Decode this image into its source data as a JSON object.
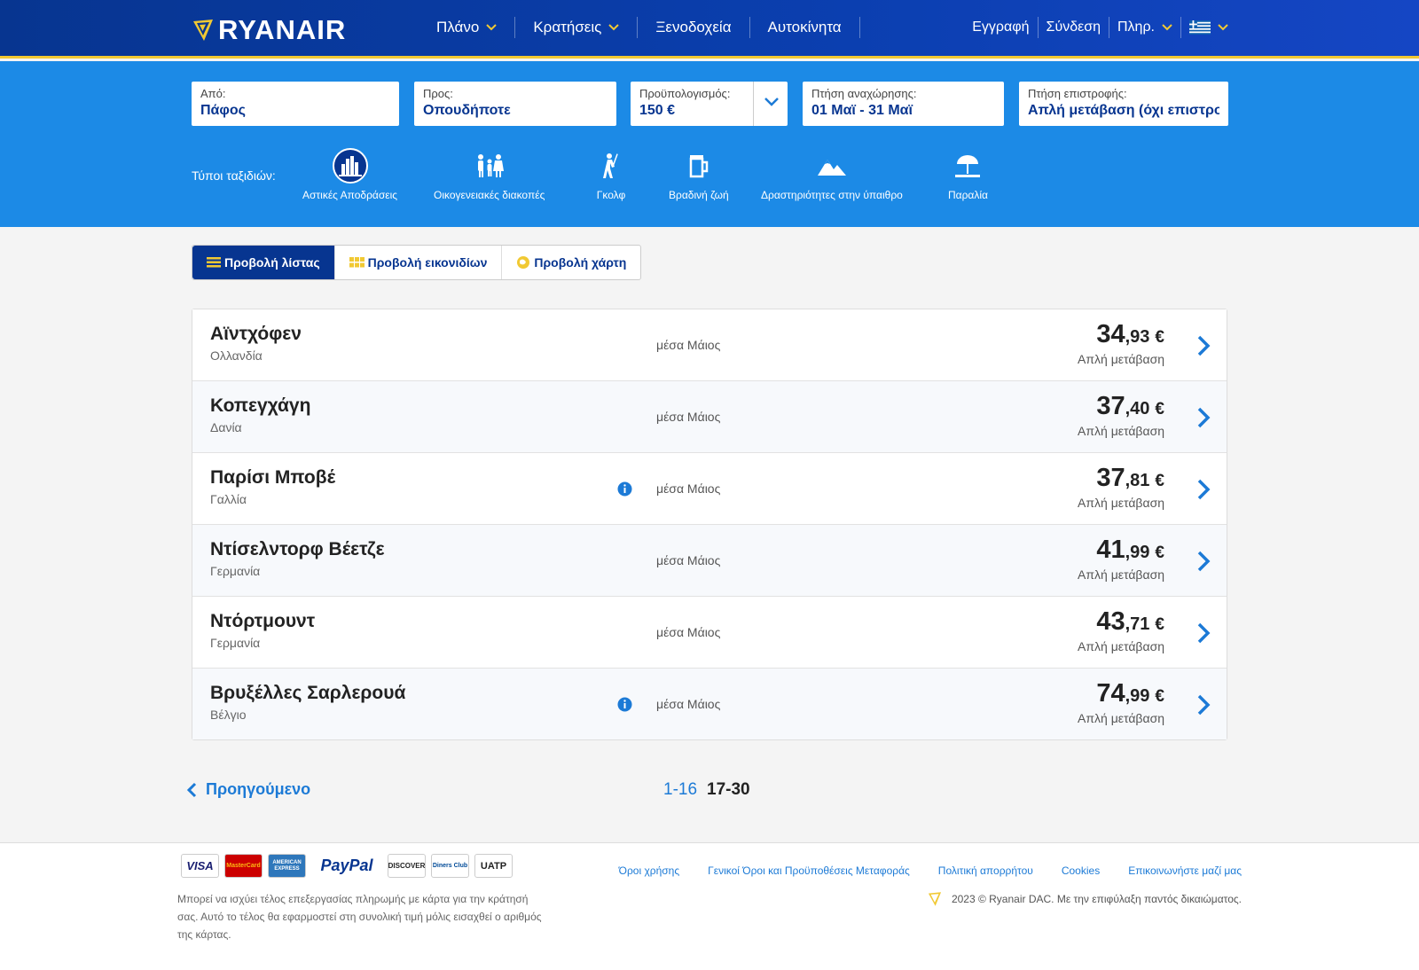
{
  "brand": {
    "name": "RYANAIR"
  },
  "nav": {
    "left": [
      {
        "label": "Πλάνο",
        "has_dropdown": true
      },
      {
        "label": "Κρατήσεις",
        "has_dropdown": true
      },
      {
        "label": "Ξενοδοχεία",
        "has_dropdown": false
      },
      {
        "label": "Αυτοκίνητα",
        "has_dropdown": false
      }
    ],
    "right": [
      {
        "label": "Εγγραφή"
      },
      {
        "label": "Σύνδεση"
      },
      {
        "label": "Πληρ."
      }
    ],
    "language_icon": "greece-flag-icon"
  },
  "search": {
    "from": {
      "label": "Από:",
      "value": "Πάφος"
    },
    "to": {
      "label": "Προς:",
      "value": "Οπουδήποτε"
    },
    "budget": {
      "label": "Προϋπολογισμός:",
      "value": "150 €"
    },
    "departure": {
      "label": "Πτήση αναχώρησης:",
      "value": "01 Μαϊ - 31 Μαϊ"
    },
    "return": {
      "label": "Πτήση επιστροφής:",
      "value": "Απλή μετάβαση (όχι επιστροφή)"
    }
  },
  "trip_types": {
    "label": "Τύποι ταξιδιών:",
    "items": [
      {
        "label": "Αστικές Αποδράσεις",
        "icon": "city-icon",
        "active": true
      },
      {
        "label": "Οικογενειακές διακοπές",
        "icon": "family-icon",
        "active": false
      },
      {
        "label": "Γκολφ",
        "icon": "golf-icon",
        "active": false
      },
      {
        "label": "Βραδινή ζωή",
        "icon": "beer-icon",
        "active": false
      },
      {
        "label": "Δραστηριότητες στην ύπαιθρο",
        "icon": "mountains-icon",
        "active": false
      },
      {
        "label": "Παραλία",
        "icon": "beach-icon",
        "active": false
      }
    ]
  },
  "views": {
    "list": "Προβολή λίστας",
    "grid": "Προβολή εικονιδίων",
    "map": "Προβολή χάρτη"
  },
  "results": [
    {
      "city": "Αϊντχόφεν",
      "country": "Ολλανδία",
      "info": false,
      "when": "μέσα Μάιος",
      "price_int": "34",
      "price_dec": ",93",
      "currency": "€",
      "type": "Απλή μετάβαση"
    },
    {
      "city": "Κοπεγχάγη",
      "country": "Δανία",
      "info": false,
      "when": "μέσα Μάιος",
      "price_int": "37",
      "price_dec": ",40",
      "currency": "€",
      "type": "Απλή μετάβαση"
    },
    {
      "city": "Παρίσι Μποβέ",
      "country": "Γαλλία",
      "info": true,
      "when": "μέσα Μάιος",
      "price_int": "37",
      "price_dec": ",81",
      "currency": "€",
      "type": "Απλή μετάβαση"
    },
    {
      "city": "Ντίσελντορφ Βέετζε",
      "country": "Γερμανία",
      "info": false,
      "when": "μέσα Μάιος",
      "price_int": "41",
      "price_dec": ",99",
      "currency": "€",
      "type": "Απλή μετάβαση"
    },
    {
      "city": "Ντόρτμουντ",
      "country": "Γερμανία",
      "info": false,
      "when": "μέσα Μάιος",
      "price_int": "43",
      "price_dec": ",71",
      "currency": "€",
      "type": "Απλή μετάβαση"
    },
    {
      "city": "Βρυξέλλες Σαρλερουά",
      "country": "Βέλγιο",
      "info": true,
      "when": "μέσα Μάιος",
      "price_int": "74",
      "price_dec": ",99",
      "currency": "€",
      "type": "Απλή μετάβαση"
    }
  ],
  "pagination": {
    "prev": "Προηγούμενο",
    "pages": [
      {
        "label": "1-16",
        "current": false
      },
      {
        "label": "17-30",
        "current": true
      }
    ]
  },
  "footer": {
    "cards": [
      "VISA",
      "MasterCard",
      "AMERICAN EXPRESS",
      "PayPal",
      "DISCOVER",
      "Diners Club",
      "UATP"
    ],
    "note": "Μπορεί να ισχύει τέλος επεξεργασίας πληρωμής με κάρτα για την κράτησή σας. Αυτό το τέλος θα εφαρμοστεί στη συνολική τιμή μόλις εισαχθεί ο αριθμός της κάρτας.",
    "links": [
      "Όροι χρήσης",
      "Γενικοί Όροι και Προϋποθέσεις Μεταφοράς",
      "Πολιτική απορρήτου",
      "Cookies",
      "Επικοινωνήστε μαζί μας"
    ],
    "copyright": "2023 © Ryanair DAC. Με την επιφύλαξη παντός δικαιώματος."
  },
  "colors": {
    "nav_blue": "#073590",
    "band_blue": "#1c8ae6",
    "accent_yellow": "#f1c933",
    "link_blue": "#1c7ad6"
  }
}
